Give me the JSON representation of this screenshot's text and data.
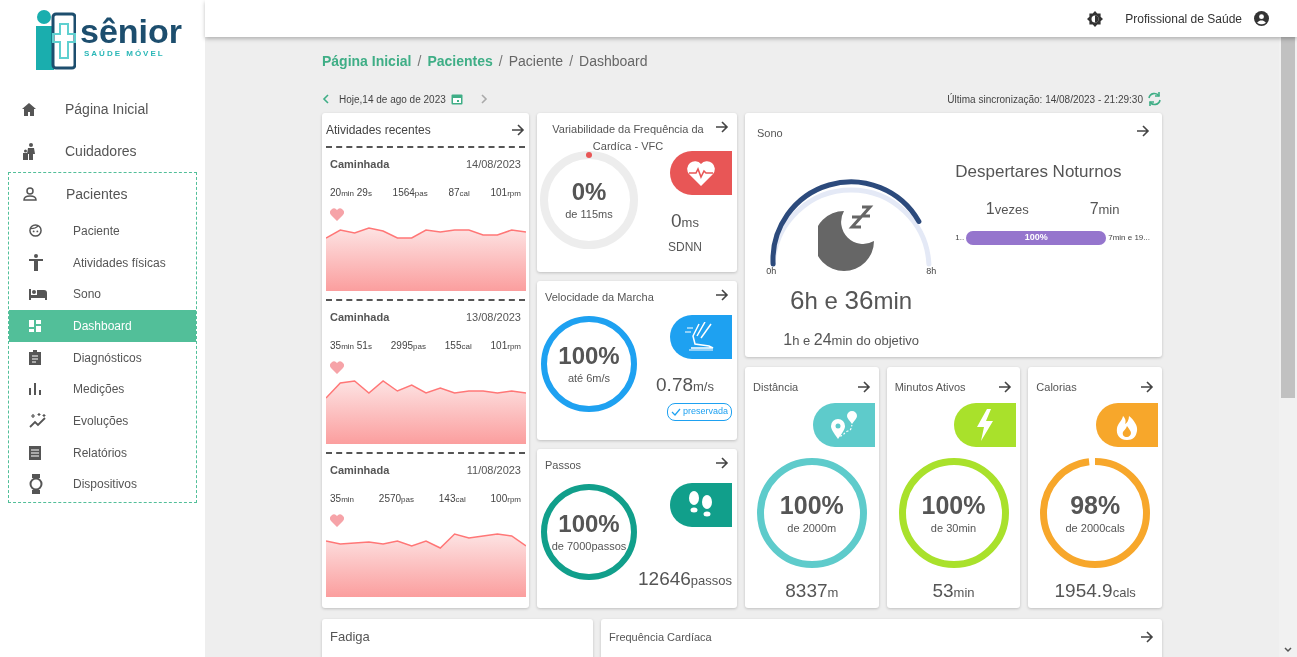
{
  "logo": {
    "name": "sênior",
    "tagline": "SAÚDE MÓVEL"
  },
  "header": {
    "user": "Profissional de Saúde"
  },
  "sidebar": {
    "items": [
      {
        "label": "Página Inicial",
        "selected": false
      },
      {
        "label": "Cuidadores",
        "selected": false
      },
      {
        "label": "Pacientes",
        "selected": false,
        "expanded": true,
        "children": [
          {
            "label": "Paciente",
            "selected": false
          },
          {
            "label": "Atividades físicas",
            "selected": false
          },
          {
            "label": "Sono",
            "selected": false
          },
          {
            "label": "Dashboard",
            "selected": true
          },
          {
            "label": "Diagnósticos",
            "selected": false
          },
          {
            "label": "Medições",
            "selected": false
          },
          {
            "label": "Evoluções",
            "selected": false
          },
          {
            "label": "Relatórios",
            "selected": false
          },
          {
            "label": "Dispositivos",
            "selected": false
          }
        ]
      }
    ]
  },
  "breadcrumb": [
    {
      "kind": "link",
      "label": "Página Inicial"
    },
    {
      "kind": "separator",
      "label": "/"
    },
    {
      "kind": "link",
      "label": "Pacientes"
    },
    {
      "kind": "separator",
      "label": "/"
    },
    {
      "kind": "text",
      "label": "Paciente"
    },
    {
      "kind": "separator",
      "label": "/"
    },
    {
      "kind": "text",
      "label": "Dashboard"
    }
  ],
  "date": {
    "label": "Hoje,14 de ago de 2023"
  },
  "sync": {
    "label": "Última sincronização: 14/08/2023 - 21:29:30"
  },
  "activities": {
    "title": "Atividades recentes",
    "items": [
      {
        "name": "Caminhada",
        "date": "14/08/2023",
        "stats": [
          [
            {
              "v": "20",
              "u": "min"
            },
            {
              "v": "29",
              "u": "s"
            }
          ],
          [
            {
              "v": "1564",
              "u": "pas"
            }
          ],
          [
            {
              "v": "87",
              "u": "cal"
            }
          ],
          [
            {
              "v": "101",
              "u": "rpm"
            }
          ]
        ]
      },
      {
        "name": "Caminhada",
        "date": "13/08/2023",
        "stats": [
          [
            {
              "v": "35",
              "u": "min"
            },
            {
              "v": "51",
              "u": "s"
            }
          ],
          [
            {
              "v": "2995",
              "u": "pas"
            }
          ],
          [
            {
              "v": "155",
              "u": "cal"
            }
          ],
          [
            {
              "v": "101",
              "u": "rpm"
            }
          ]
        ]
      },
      {
        "name": "Caminhada",
        "date": "11/08/2023",
        "stats": [
          [
            {
              "v": "35",
              "u": "min"
            }
          ],
          [
            {
              "v": "2570",
              "u": "pas"
            }
          ],
          [
            {
              "v": "143",
              "u": "cal"
            }
          ],
          [
            {
              "v": "100",
              "u": "rpm"
            }
          ]
        ]
      }
    ]
  },
  "vitals": [
    {
      "kind": "hrv",
      "title": "Variabilidade da Frequência da Cardíca - VFC",
      "level": 0,
      "percent": "0%",
      "sub": "de 115ms",
      "value": "0",
      "unit": "ms",
      "label": "SDNN",
      "color": "#e85656"
    },
    {
      "kind": "gait",
      "title": "Velocidade da Marcha",
      "level": 1,
      "percent": "100%",
      "sub": "até 6m/s",
      "value": "0.78",
      "unit": "m/s",
      "badge": "preservada",
      "color": "#1ea1f1"
    },
    {
      "kind": "steps",
      "title": "Passos",
      "level": 1,
      "percent": "100%",
      "sub": "de 7000passos",
      "value": "12646",
      "unit": "passos",
      "color": "#119f8b"
    }
  ],
  "sleep": {
    "title": "Sono",
    "tick_start": "0h",
    "tick_end": "8h",
    "total": [
      {
        "v": "6",
        "u": "h e "
      },
      {
        "v": "36",
        "u": "min"
      }
    ],
    "goal": [
      {
        "v": "1",
        "u": "h e "
      },
      {
        "v": "24",
        "u": "min do objetivo"
      }
    ],
    "awakenings": {
      "title": "Despertares Noturnos",
      "count": {
        "v": "1",
        "u": "vezes"
      },
      "duration": {
        "v": "7",
        "u": "min"
      },
      "bar": {
        "start": "1..",
        "level": 1,
        "text": "100%",
        "end": "7min e 19..."
      }
    }
  },
  "metrics": [
    {
      "kind": "distance",
      "title": "Distância",
      "level": 1,
      "percent": "100%",
      "sub": "de 2000m",
      "value": "8337",
      "unit": "m",
      "color": "#5ecbcb"
    },
    {
      "kind": "active",
      "title": "Minutos Ativos",
      "level": 1,
      "percent": "100%",
      "sub": "de 30min",
      "value": "53",
      "unit": "min",
      "color": "#a9e12b"
    },
    {
      "kind": "calories",
      "title": "Calorias",
      "level": 0.98,
      "percent": "98%",
      "sub": "de 2000cals",
      "value": "1954.9",
      "unit": "cals",
      "color": "#f7a72b"
    }
  ],
  "bottom_cards": [
    {
      "title": "Fadiga",
      "arrow": false
    },
    {
      "title": "Frequência Cardíaca",
      "arrow": true
    }
  ]
}
